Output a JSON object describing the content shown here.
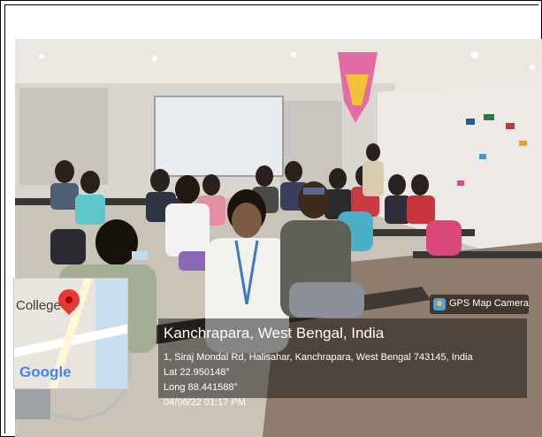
{
  "stamp": {
    "app_name": "GPS Map Camera",
    "place": "Kanchrapara, West Bengal, India",
    "address": "1, Siraj Mondal Rd, Halisahar, Kanchrapara, West Bengal 743145, India",
    "lat": "Lat 22.950148°",
    "long": "Long 88.441588°",
    "datetime": "04/06/22 01:17 PM"
  },
  "map": {
    "label": "College",
    "logo": "Google"
  },
  "icons": [
    "map-pin-icon",
    "camera-app-icon"
  ]
}
